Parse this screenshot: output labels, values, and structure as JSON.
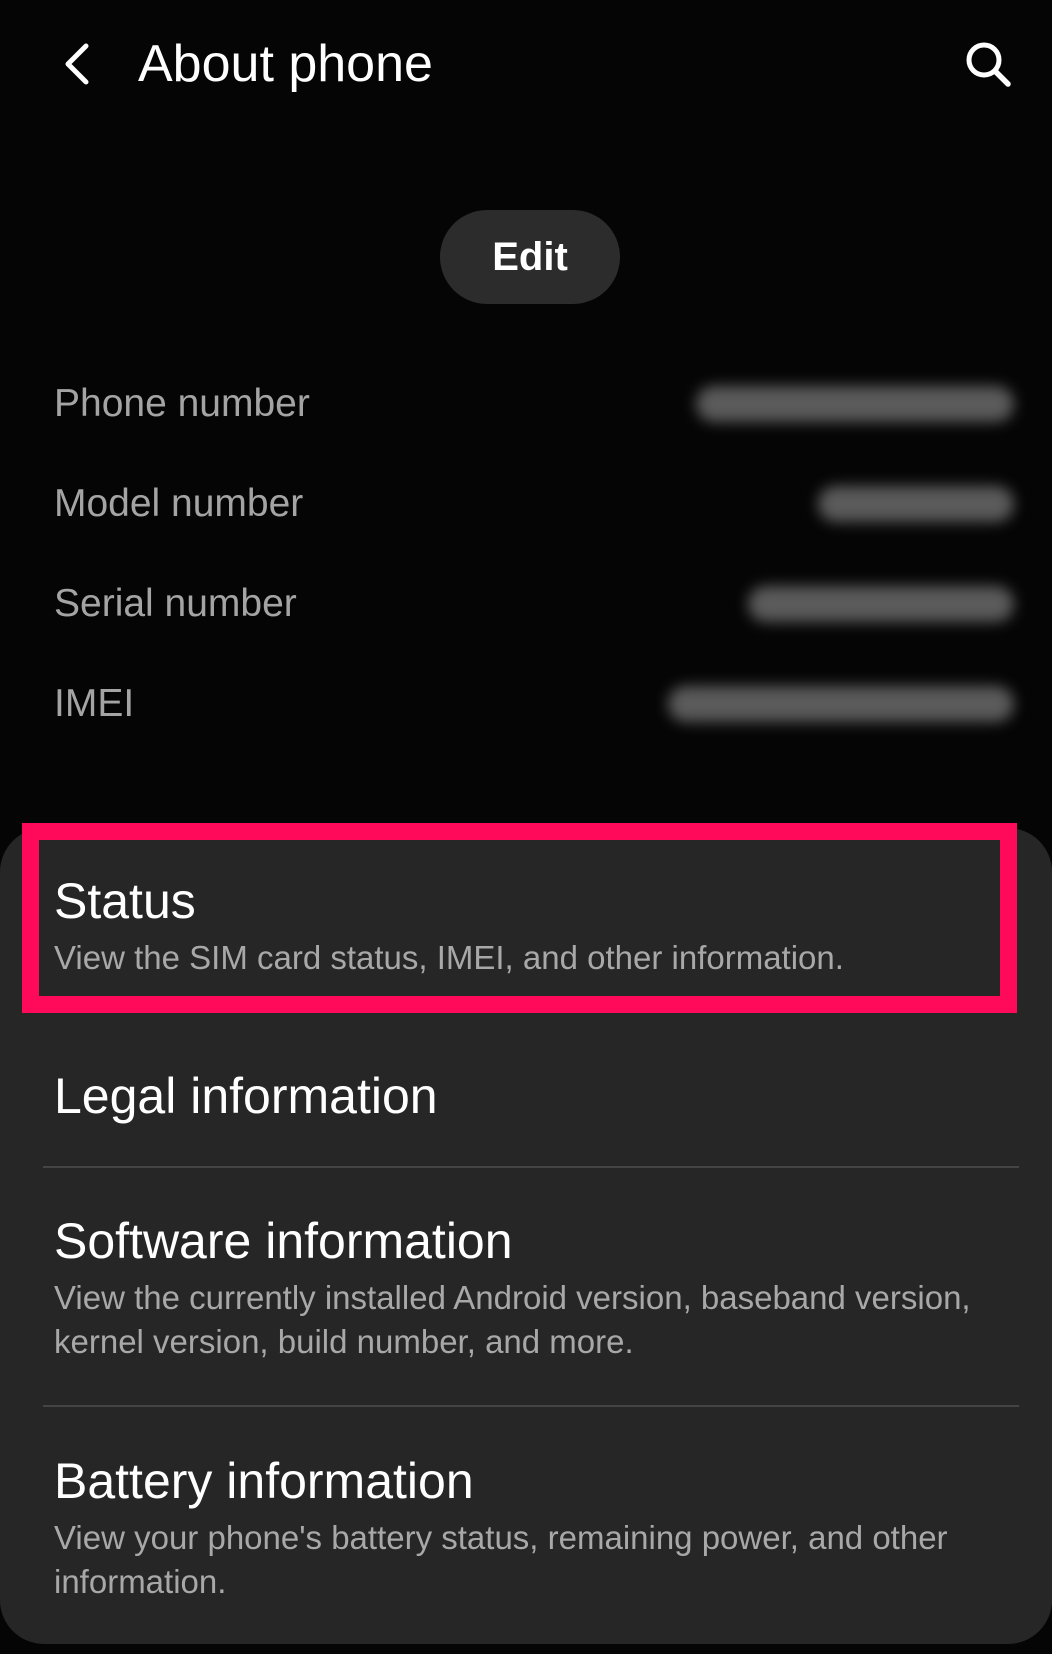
{
  "header": {
    "title": "About phone",
    "back_icon": "chevron-left-icon",
    "search_icon": "search-icon"
  },
  "edit_label": "Edit",
  "info": [
    {
      "label": "Phone number",
      "value": ""
    },
    {
      "label": "Model number",
      "value": ""
    },
    {
      "label": "Serial number",
      "value": ""
    },
    {
      "label": "IMEI",
      "value": ""
    }
  ],
  "menu": [
    {
      "title": "Status",
      "description": "View the SIM card status, IMEI, and other information."
    },
    {
      "title": "Legal information",
      "description": ""
    },
    {
      "title": "Software information",
      "description": "View the currently installed Android version, baseband version, kernel version, build number, and more."
    },
    {
      "title": "Battery information",
      "description": "View your phone's battery status, remaining power, and other information."
    }
  ],
  "colors": {
    "background": "#050505",
    "card": "#262626",
    "highlight": "#ff0a5a",
    "secondary_text": "#a4a4a4"
  }
}
